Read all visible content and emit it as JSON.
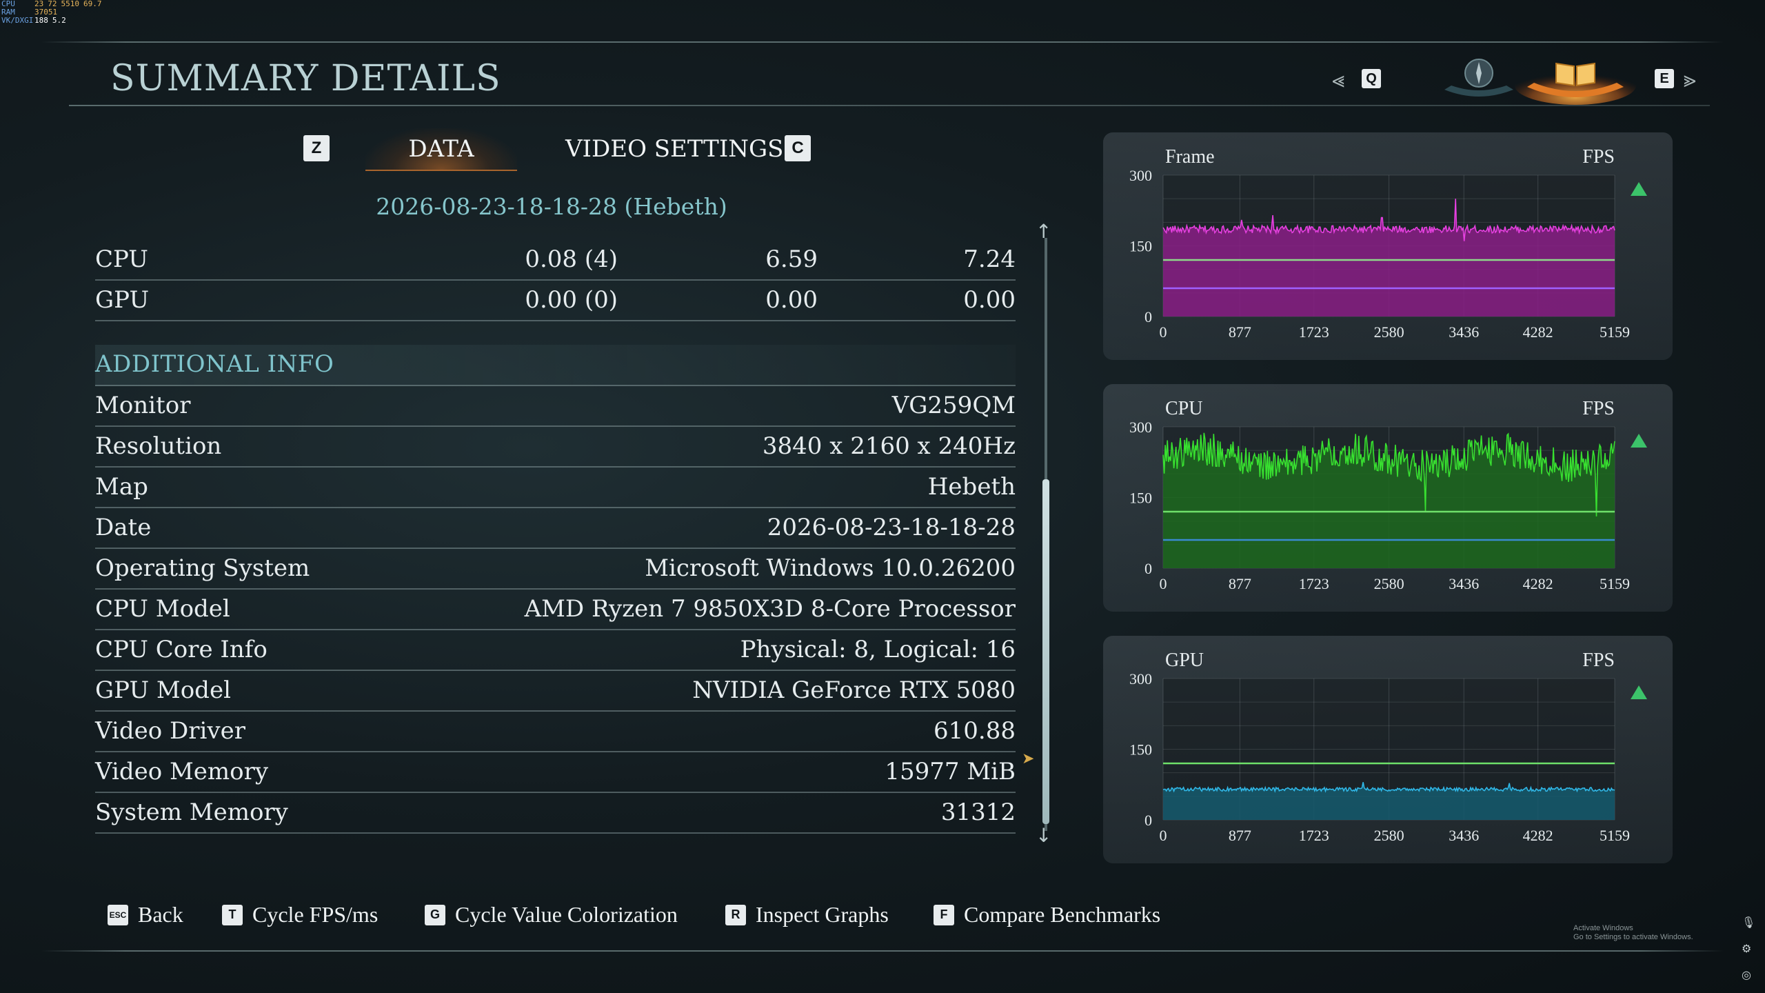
{
  "overlay": {
    "rows": [
      {
        "label": "CPU",
        "values": [
          "23",
          "72",
          "5510",
          "69.7"
        ]
      },
      {
        "label": "RAM",
        "values": [
          "37051"
        ]
      },
      {
        "label": "VK/DXGI",
        "values": [
          "188",
          "5.2"
        ]
      }
    ]
  },
  "header": {
    "title": "SUMMARY DETAILS",
    "nav_keys": {
      "left": "Q",
      "right": "E"
    },
    "icons": [
      "chevron-left-icon",
      "compass-icon",
      "book-icon",
      "chevron-right-icon"
    ]
  },
  "tabs": {
    "left_key": "Z",
    "right_key": "C",
    "items": [
      {
        "label": "DATA",
        "active": true
      },
      {
        "label": "VIDEO SETTINGS",
        "active": false
      }
    ]
  },
  "run_id": "2026-08-23-18-18-28 (Hebeth)",
  "perf_rows": [
    {
      "name": "CPU",
      "v1": "0.08 (4)",
      "v2": "6.59",
      "v3": "7.24"
    },
    {
      "name": "GPU",
      "v1": "0.00 (0)",
      "v2": "0.00",
      "v3": "0.00"
    }
  ],
  "additional_info": {
    "heading": "ADDITIONAL INFO",
    "rows": [
      {
        "key": "Monitor",
        "value": "VG259QM"
      },
      {
        "key": "Resolution",
        "value": "3840 x 2160 x 240Hz"
      },
      {
        "key": "Map",
        "value": "Hebeth"
      },
      {
        "key": "Date",
        "value": "2026-08-23-18-18-28"
      },
      {
        "key": "Operating System",
        "value": "Microsoft Windows 10.0.26200"
      },
      {
        "key": "CPU Model",
        "value": "AMD Ryzen 7 9850X3D 8-Core Processor"
      },
      {
        "key": "CPU Core Info",
        "value": "Physical: 8, Logical: 16"
      },
      {
        "key": "GPU Model",
        "value": "NVIDIA GeForce RTX 5080"
      },
      {
        "key": "Video Driver",
        "value": "610.88"
      },
      {
        "key": "Video Memory",
        "value": "15977 MiB"
      },
      {
        "key": "System Memory",
        "value": "31312"
      }
    ]
  },
  "chart_data": [
    {
      "type": "line",
      "title": "Frame",
      "unit_label": "FPS",
      "x_ticks": [
        0,
        877,
        1723,
        2580,
        3436,
        4282,
        5159
      ],
      "y_ticks": [
        0,
        150,
        300
      ],
      "ylim": [
        0,
        300
      ],
      "xlim": [
        0,
        5159
      ],
      "series": [
        {
          "key": "main",
          "color": "#e640e0",
          "fill": "#8a1f86",
          "mean": 185,
          "noise": 8,
          "spikes": [
            [
              900,
              205
            ],
            [
              1250,
              215
            ],
            [
              2500,
              210
            ],
            [
              3340,
              250
            ],
            [
              3440,
              160
            ],
            [
              3500,
              178
            ]
          ]
        }
      ],
      "reference_lines": [
        {
          "value": 120,
          "color": "#8fd98a"
        },
        {
          "value": 60,
          "color": "#a060ff"
        }
      ]
    },
    {
      "type": "line",
      "title": "CPU",
      "unit_label": "FPS",
      "x_ticks": [
        0,
        877,
        1723,
        2580,
        3436,
        4282,
        5159
      ],
      "y_ticks": [
        0,
        150,
        300
      ],
      "ylim": [
        0,
        300
      ],
      "xlim": [
        0,
        5159
      ],
      "series": [
        {
          "key": "main",
          "color": "#38e030",
          "fill": "#1d6a1e",
          "mean": 235,
          "noise": 35,
          "spikes": [
            [
              3000,
              120
            ],
            [
              4950,
              110
            ]
          ]
        }
      ],
      "reference_lines": [
        {
          "value": 120,
          "color": "#6ee06a"
        },
        {
          "value": 60,
          "color": "#3a8ad0"
        }
      ]
    },
    {
      "type": "line",
      "title": "GPU",
      "unit_label": "FPS",
      "x_ticks": [
        0,
        877,
        1723,
        2580,
        3436,
        4282,
        5159
      ],
      "y_ticks": [
        0,
        150,
        300
      ],
      "ylim": [
        0,
        300
      ],
      "xlim": [
        0,
        5159
      ],
      "series": [
        {
          "key": "main",
          "color": "#30b8e8",
          "fill": "#155a6e",
          "mean": 65,
          "noise": 4,
          "spikes": [
            [
              2280,
              80
            ],
            [
              3960,
              78
            ]
          ]
        }
      ],
      "reference_lines": [
        {
          "value": 120,
          "color": "#6ee06a"
        }
      ]
    }
  ],
  "footer": {
    "items": [
      {
        "key": "ESC",
        "label": "Back"
      },
      {
        "key": "T",
        "label": "Cycle FPS/ms"
      },
      {
        "key": "G",
        "label": "Cycle Value Colorization"
      },
      {
        "key": "R",
        "label": "Inspect Graphs"
      },
      {
        "key": "F",
        "label": "Compare Benchmarks"
      }
    ]
  },
  "watermark": {
    "line1": "Activate Windows",
    "line2": "Go to Settings to activate Windows."
  },
  "colors": {
    "accent_teal": "#86c6cc",
    "tab_glow": "#e08232"
  }
}
